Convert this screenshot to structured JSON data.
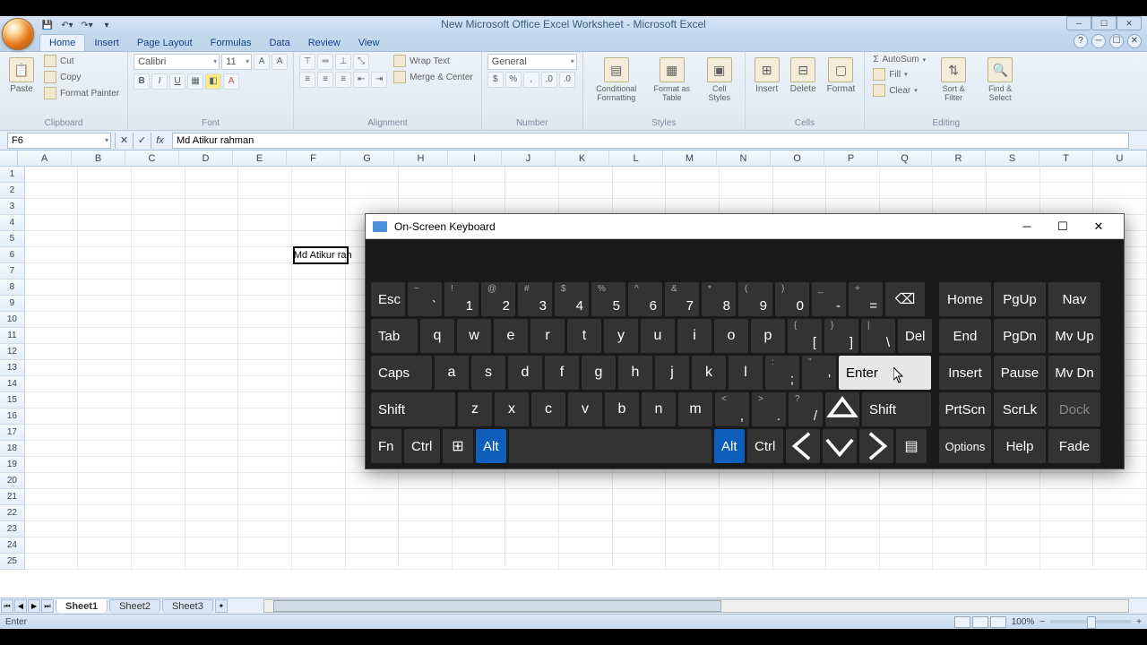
{
  "title": "New Microsoft Office Excel Worksheet - Microsoft Excel",
  "tabs": [
    "Home",
    "Insert",
    "Page Layout",
    "Formulas",
    "Data",
    "Review",
    "View"
  ],
  "active_tab": 0,
  "clipboard": {
    "paste": "Paste",
    "cut": "Cut",
    "copy": "Copy",
    "format_painter": "Format Painter",
    "label": "Clipboard"
  },
  "font": {
    "name": "Calibri",
    "size": "11",
    "label": "Font"
  },
  "alignment": {
    "wrap": "Wrap Text",
    "merge": "Merge & Center",
    "label": "Alignment"
  },
  "number": {
    "format": "General",
    "label": "Number"
  },
  "styles": {
    "cf": "Conditional Formatting",
    "fat": "Format as Table",
    "cs": "Cell Styles",
    "label": "Styles"
  },
  "cells": {
    "insert": "Insert",
    "delete": "Delete",
    "format": "Format",
    "label": "Cells"
  },
  "editing": {
    "autosum": "AutoSum",
    "fill": "Fill",
    "clear": "Clear",
    "sort": "Sort & Filter",
    "find": "Find & Select",
    "label": "Editing"
  },
  "namebox": "F6",
  "formula": "Md Atikur rahman",
  "columns": [
    "A",
    "B",
    "C",
    "D",
    "E",
    "F",
    "G",
    "H",
    "I",
    "J",
    "K",
    "L",
    "M",
    "N",
    "O",
    "P",
    "Q",
    "R",
    "S",
    "T",
    "U"
  ],
  "row_count": 25,
  "active_cell": {
    "row": 6,
    "col": "F"
  },
  "cell_content": {
    "F6": "Md Atikur rah"
  },
  "sheets": [
    "Sheet1",
    "Sheet2",
    "Sheet3"
  ],
  "status": "Enter",
  "zoom": "100%",
  "osk": {
    "title": "On-Screen Keyboard",
    "row1": {
      "esc": "Esc",
      "nums": [
        {
          "k": "`",
          "s": "~"
        },
        {
          "k": "1",
          "s": "!"
        },
        {
          "k": "2",
          "s": "@"
        },
        {
          "k": "3",
          "s": "#"
        },
        {
          "k": "4",
          "s": "$"
        },
        {
          "k": "5",
          "s": "%"
        },
        {
          "k": "6",
          "s": "^"
        },
        {
          "k": "7",
          "s": "&"
        },
        {
          "k": "8",
          "s": "*"
        },
        {
          "k": "9",
          "s": "("
        },
        {
          "k": "0",
          "s": ")"
        },
        {
          "k": "-",
          "s": "_"
        },
        {
          "k": "=",
          "s": "+"
        }
      ],
      "bksp": "⌫"
    },
    "row2": {
      "tab": "Tab",
      "keys": [
        "q",
        "w",
        "e",
        "r",
        "t",
        "y",
        "u",
        "i",
        "o",
        "p"
      ],
      "br1": {
        "k": "[",
        "s": "{"
      },
      "br2": {
        "k": "]",
        "s": "}"
      },
      "bs": {
        "k": "\\",
        "s": "|"
      },
      "del": "Del"
    },
    "row3": {
      "caps": "Caps",
      "keys": [
        "a",
        "s",
        "d",
        "f",
        "g",
        "h",
        "j",
        "k",
        "l"
      ],
      "sc": {
        "k": ";",
        "s": ":"
      },
      "ap": {
        "k": "'",
        "s": "\""
      },
      "enter": "Enter"
    },
    "row4": {
      "shift": "Shift",
      "keys": [
        "z",
        "x",
        "c",
        "v",
        "b",
        "n",
        "m"
      ],
      "cm": {
        "k": ",",
        "s": "<"
      },
      "pd": {
        "k": ".",
        "s": ">"
      },
      "sl": {
        "k": "/",
        "s": "?"
      },
      "up": "↑",
      "shift2": "Shift"
    },
    "row5": {
      "fn": "Fn",
      "ctrl": "Ctrl",
      "win": "⊞",
      "alt": "Alt",
      "alt2": "Alt",
      "ctrl2": "Ctrl",
      "left": "<",
      "down": "v",
      "right": ">",
      "menu": "▤"
    },
    "side": [
      [
        "Home",
        "PgUp",
        "Nav"
      ],
      [
        "End",
        "PgDn",
        "Mv Up"
      ],
      [
        "Insert",
        "Pause",
        "Mv Dn"
      ],
      [
        "PrtScn",
        "ScrLk",
        "Dock"
      ],
      [
        "Options",
        "Help",
        "Fade"
      ]
    ]
  }
}
